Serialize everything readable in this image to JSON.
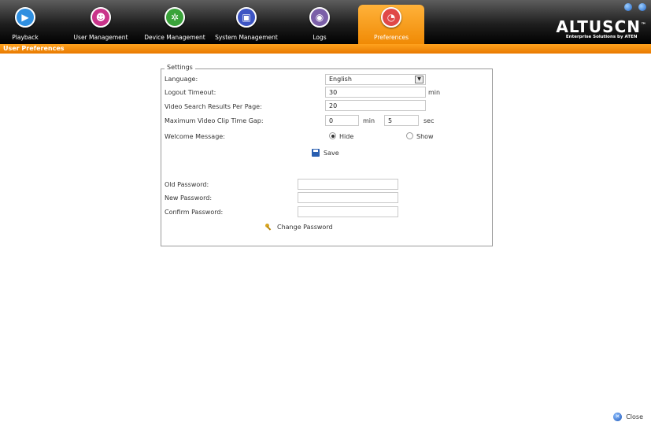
{
  "nav": {
    "tabs": [
      {
        "label": "Playback",
        "icon": "play-icon",
        "color": "#2f8fe0"
      },
      {
        "label": "User Management",
        "icon": "users-icon",
        "color": "#c9338a"
      },
      {
        "label": "Device Management",
        "icon": "device-icon",
        "color": "#3aa33a"
      },
      {
        "label": "System Management",
        "icon": "monitor-icon",
        "color": "#3d55c4"
      },
      {
        "label": "Logs",
        "icon": "logs-icon",
        "color": "#7b5fa8"
      },
      {
        "label": "Preferences",
        "icon": "preferences-icon",
        "color": "#e04848",
        "active": true
      }
    ],
    "brand": {
      "name": "ALTUSCN",
      "trademark": "™",
      "tagline": "Enterprise Solutions by ATEN"
    }
  },
  "section_title": "User Preferences",
  "settings": {
    "legend": "Settings",
    "language": {
      "label": "Language:",
      "value": "English"
    },
    "logout_timeout": {
      "label": "Logout Timeout:",
      "value": "30",
      "unit": "min"
    },
    "video_search": {
      "label": "Video Search Results Per Page:",
      "value": "20"
    },
    "max_clip_gap": {
      "label": "Maximum Video Clip Time Gap:",
      "min_value": "0",
      "min_unit": "min",
      "sec_value": "5",
      "sec_unit": "sec"
    },
    "welcome": {
      "label": "Welcome Message:",
      "hide": "Hide",
      "show": "Show",
      "selected": "Hide"
    },
    "save_label": "Save"
  },
  "password": {
    "old_label": "Old Password:",
    "new_label": "New Password:",
    "confirm_label": "Confirm Password:",
    "old_value": "",
    "new_value": "",
    "confirm_value": "",
    "change_label": "Change Password"
  },
  "footer": {
    "close_label": "Close"
  },
  "colors": {
    "accent": "#f08a05",
    "nav_bg": "#1e1e1e"
  }
}
